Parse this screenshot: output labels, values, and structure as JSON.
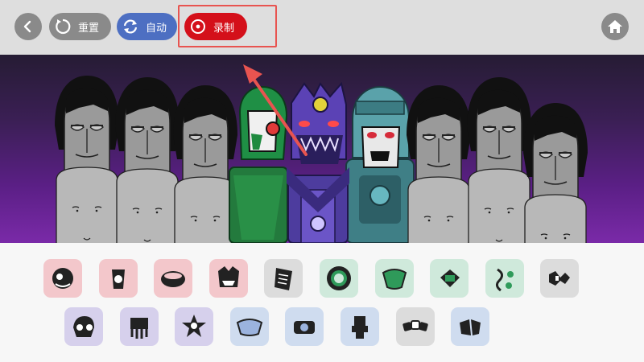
{
  "toolbar": {
    "back_icon": "chevron-left-icon",
    "reset_label": "重置",
    "auto_label": "自动",
    "record_label": "录制",
    "home_icon": "home-icon"
  },
  "colors": {
    "topbar": "#dedede",
    "button_gray": "#8a8a8a",
    "auto_blue": "#4d6fc2",
    "record_red": "#d4101a",
    "highlight_red": "#e85450",
    "stage_top": "#261c34",
    "stage_bottom": "#7a2aa8",
    "annotation_arrow": "#e85450"
  },
  "stage": {
    "characters": [
      {
        "name": "gray-character-1",
        "state": "idle"
      },
      {
        "name": "gray-character-2",
        "state": "idle"
      },
      {
        "name": "gray-character-3",
        "state": "idle"
      },
      {
        "name": "green-masked-character",
        "state": "active"
      },
      {
        "name": "purple-horned-character",
        "state": "active"
      },
      {
        "name": "teal-helmet-character",
        "state": "active"
      },
      {
        "name": "gray-character-4",
        "state": "idle"
      },
      {
        "name": "gray-character-5",
        "state": "idle"
      },
      {
        "name": "gray-character-6",
        "state": "idle"
      }
    ]
  },
  "sound_icons": {
    "row1": [
      {
        "icon": "face-sound-icon",
        "color": "#f3c7cb"
      },
      {
        "icon": "cup-sound-icon",
        "color": "#f3c7cb"
      },
      {
        "icon": "bowl-sound-icon",
        "color": "#f3c7cb"
      },
      {
        "icon": "monster-face-sound-icon",
        "color": "#f3c7cb"
      },
      {
        "icon": "note-sheet-sound-icon",
        "color": "#dcdcdc"
      },
      {
        "icon": "gear-ring-sound-icon",
        "color": "#cfe9db"
      },
      {
        "icon": "cloth-sound-icon",
        "color": "#cfe9db"
      },
      {
        "icon": "diamond-sound-icon",
        "color": "#cfe9db"
      },
      {
        "icon": "vine-sound-icon",
        "color": "#cfe9db"
      },
      {
        "icon": "zigzag-sound-icon",
        "color": "#dcdcdc"
      }
    ],
    "row2": [
      {
        "icon": "skull-sound-icon",
        "color": "#d6d0ec"
      },
      {
        "icon": "tentacle-face-sound-icon",
        "color": "#d6d0ec"
      },
      {
        "icon": "star-face-sound-icon",
        "color": "#d6d0ec"
      },
      {
        "icon": "visor-sound-icon",
        "color": "#cfdcef"
      },
      {
        "icon": "camera-sound-icon",
        "color": "#cfdcef"
      },
      {
        "icon": "robot-arm-sound-icon",
        "color": "#cfdcef"
      },
      {
        "icon": "chain-sound-icon",
        "color": "#dcdcdc"
      },
      {
        "icon": "wing-sound-icon",
        "color": "#cfdcef"
      }
    ]
  }
}
